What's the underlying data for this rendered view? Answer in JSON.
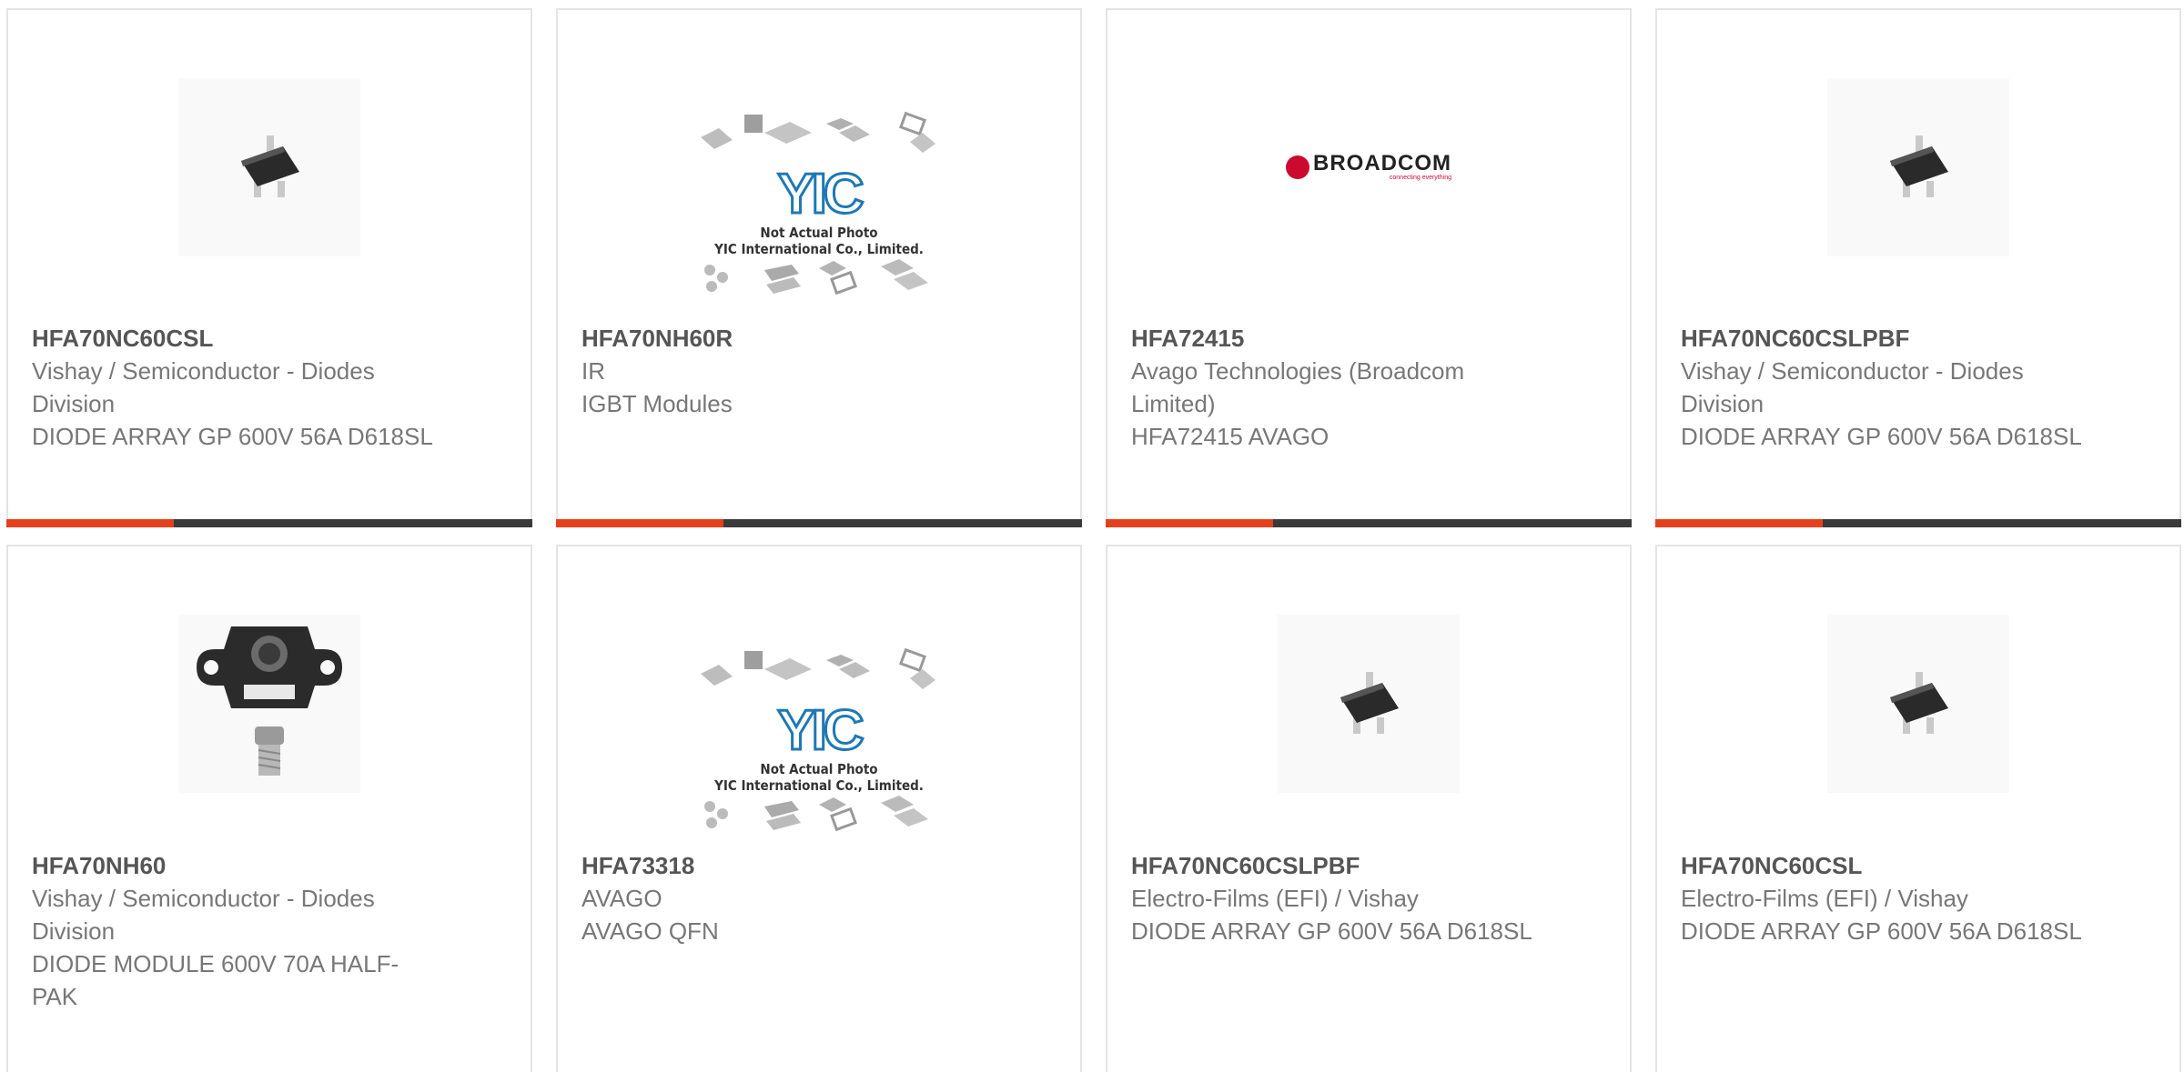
{
  "colors": {
    "accent": "#e4401c",
    "bar": "#3a3a3a",
    "border": "#e4e4e4",
    "text_bold": "#555555",
    "text": "#777777"
  },
  "placeholder": {
    "logo_text": "YIC",
    "caption_line1": "Not Actual Photo",
    "caption_line2": "YIC International Co., Limited."
  },
  "broadcom_logo": {
    "name": "BROADCOM",
    "tagline": "connecting everything"
  },
  "products": [
    {
      "part_number": "HFA70NC60CSL",
      "manufacturer": "Vishay / Semiconductor - Diodes Division",
      "description": "DIODE ARRAY GP 600V 56A D618SL",
      "image": "diode-sot-icon"
    },
    {
      "part_number": "HFA70NH60R",
      "manufacturer": "IR",
      "description": "IGBT Modules",
      "image": "not-actual-photo-placeholder"
    },
    {
      "part_number": "HFA72415",
      "manufacturer": "Avago Technologies (Broadcom Limited)",
      "description": "HFA72415 AVAGO",
      "image": "broadcom-logo"
    },
    {
      "part_number": "HFA70NC60CSLPBF",
      "manufacturer": "Vishay / Semiconductor - Diodes Division",
      "description": "DIODE ARRAY GP 600V 56A D618SL",
      "image": "diode-sot-icon"
    },
    {
      "part_number": "HFA70NH60",
      "manufacturer": "Vishay / Semiconductor - Diodes Division",
      "description": "DIODE MODULE 600V 70A HALF-PAK",
      "image": "half-pak-module-icon"
    },
    {
      "part_number": "HFA73318",
      "manufacturer": "AVAGO",
      "description": "AVAGO QFN",
      "image": "not-actual-photo-placeholder"
    },
    {
      "part_number": "HFA70NC60CSLPBF",
      "manufacturer": "Electro-Films (EFI) / Vishay",
      "description": "DIODE ARRAY GP 600V 56A D618SL",
      "image": "diode-sot-icon"
    },
    {
      "part_number": "HFA70NC60CSL",
      "manufacturer": "Electro-Films (EFI) / Vishay",
      "description": "DIODE ARRAY GP 600V 56A D618SL",
      "image": "diode-sot-icon"
    }
  ]
}
